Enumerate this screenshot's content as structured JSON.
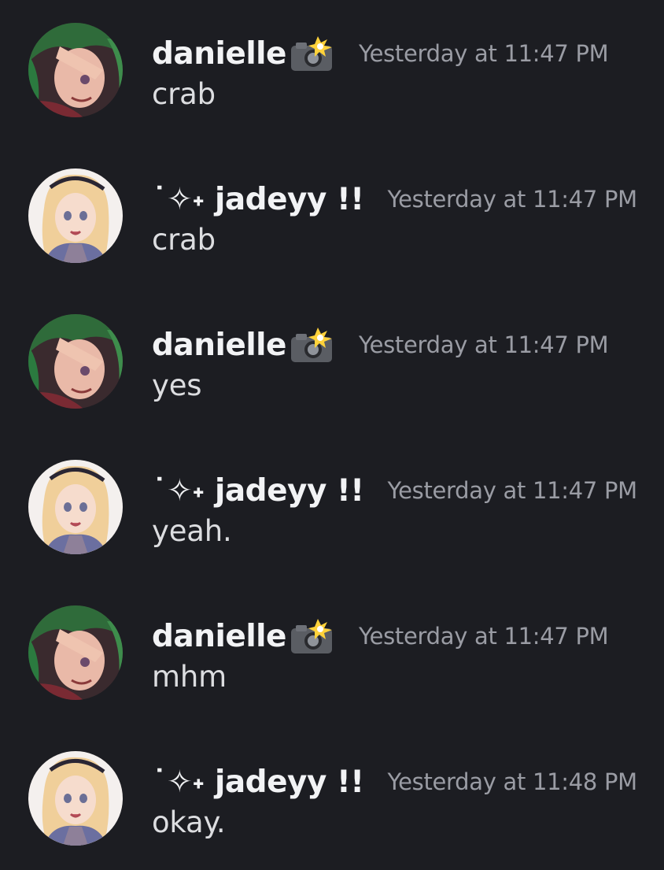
{
  "messages": [
    {
      "author": "danielle",
      "author_emoji": "camera-flash-icon",
      "time": "Yesterday at 11:47 PM",
      "text": "crab"
    },
    {
      "author": "˙✧˖ jadeyy !!",
      "author_emoji": "",
      "time": "Yesterday at 11:47 PM",
      "text": "crab"
    },
    {
      "author": "danielle",
      "author_emoji": "camera-flash-icon",
      "time": "Yesterday at 11:47 PM",
      "text": "yes"
    },
    {
      "author": "˙✧˖ jadeyy !!",
      "author_emoji": "",
      "time": "Yesterday at 11:47 PM",
      "text": "yeah."
    },
    {
      "author": "danielle",
      "author_emoji": "camera-flash-icon",
      "time": "Yesterday at 11:47 PM",
      "text": "mhm"
    },
    {
      "author": "˙✧˖ jadeyy !!",
      "author_emoji": "",
      "time": "Yesterday at 11:48 PM",
      "text": "okay."
    }
  ],
  "colors": {
    "background": "#1c1d22",
    "username": "#f2f3f5",
    "timestamp": "#9a9ca4",
    "message_text": "#dcdde0"
  }
}
